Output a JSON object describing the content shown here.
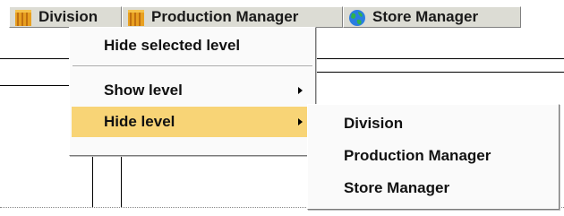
{
  "tabs": [
    {
      "label": "Division",
      "icon": "folder-icon"
    },
    {
      "label": "Production Manager",
      "icon": "folder-icon"
    },
    {
      "label": "Store Manager",
      "icon": "globe-icon"
    }
  ],
  "context_menu": {
    "items": [
      {
        "label": "Hide selected level",
        "has_submenu": false
      },
      {
        "label": "Show level",
        "has_submenu": true
      },
      {
        "label": "Hide level",
        "has_submenu": true,
        "highlighted": true
      }
    ]
  },
  "submenu": {
    "items": [
      {
        "label": "Division"
      },
      {
        "label": "Production Manager"
      },
      {
        "label": "Store Manager"
      }
    ]
  },
  "colors": {
    "highlight": "#f8d476",
    "tab_background": "#dcdcd4",
    "menu_background": "#fafafa"
  }
}
